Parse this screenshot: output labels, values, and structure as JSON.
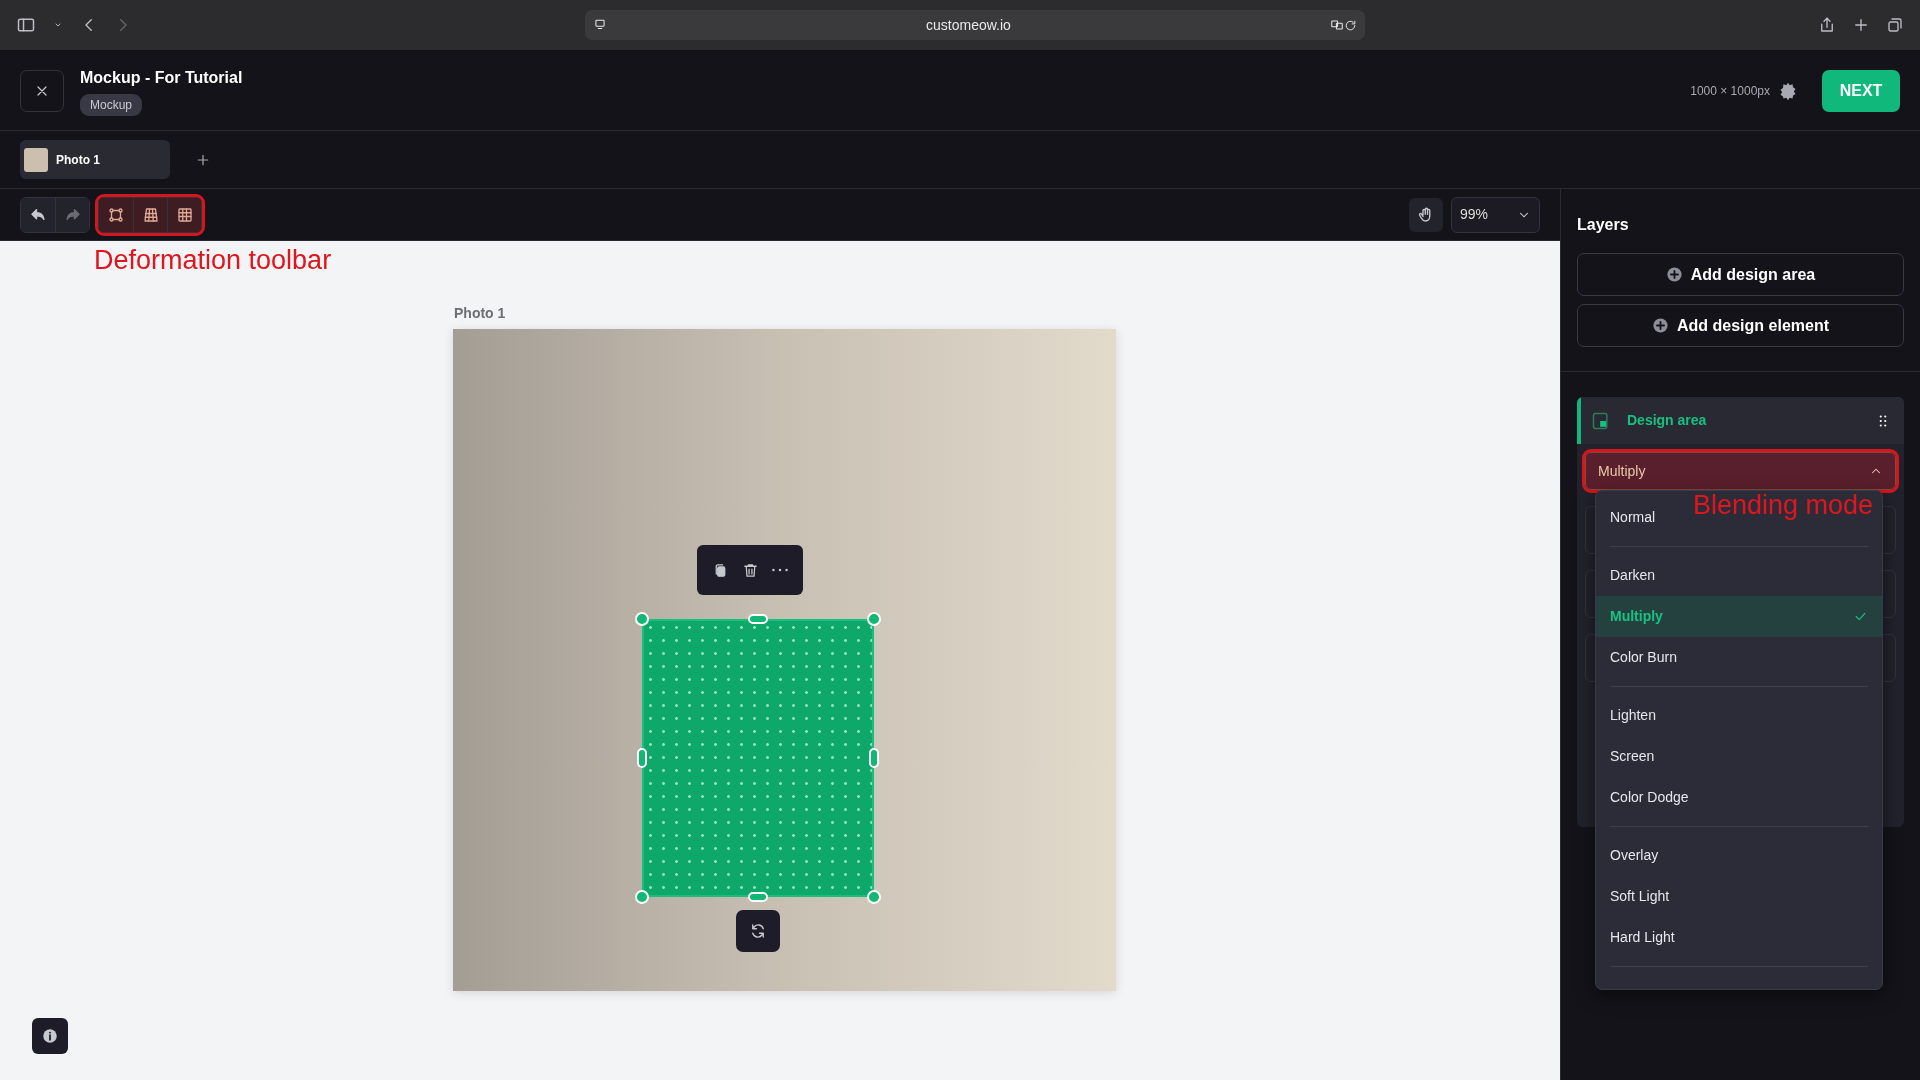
{
  "browser": {
    "url": "customeow.io"
  },
  "header": {
    "title": "Mockup - For Tutorial",
    "badge": "Mockup",
    "dimensions": "1000 × 1000px",
    "next_label": "NEXT"
  },
  "tabs": [
    {
      "label": "Photo 1",
      "selected": true
    }
  ],
  "toolbar": {
    "zoom": "99%"
  },
  "annotations": [
    {
      "text": "Deformation toolbar"
    },
    {
      "text": "Blending mode"
    }
  ],
  "canvas": {
    "photo_label": "Photo 1"
  },
  "layers": {
    "title": "Layers",
    "buttons": [
      "Add design area",
      "Add design element"
    ],
    "design_area": {
      "name": "Design area",
      "selected": true
    },
    "blend_select": {
      "value": "Multiply",
      "expanded": true
    },
    "option_groups": [
      {
        "options": [
          {
            "label": "Normal",
            "selected": false
          }
        ]
      },
      {
        "options": [
          {
            "label": "Darken",
            "selected": false
          },
          {
            "label": "Multiply",
            "selected": true
          },
          {
            "label": "Color Burn",
            "selected": false
          }
        ]
      },
      {
        "options": [
          {
            "label": "Lighten",
            "selected": false
          },
          {
            "label": "Screen",
            "selected": false
          },
          {
            "label": "Color Dodge",
            "selected": false
          }
        ]
      },
      {
        "options": [
          {
            "label": "Overlay",
            "selected": false
          },
          {
            "label": "Soft Light",
            "selected": false
          },
          {
            "label": "Hard Light",
            "selected": false
          }
        ]
      }
    ]
  }
}
